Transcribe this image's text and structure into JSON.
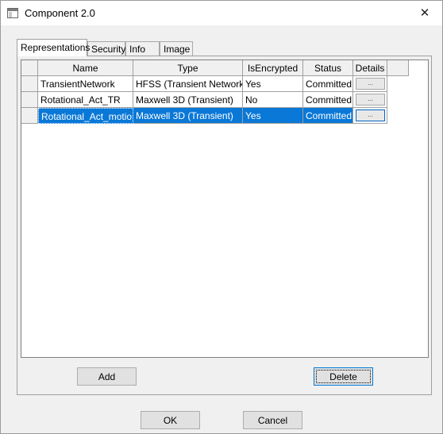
{
  "window": {
    "title": "Component 2.0",
    "close_glyph": "✕"
  },
  "tabs": [
    {
      "label": "Representations",
      "active": true
    },
    {
      "label": "Security",
      "active": false
    },
    {
      "label": "Info",
      "active": false
    },
    {
      "label": "Image",
      "active": false
    }
  ],
  "table": {
    "columns": [
      "Name",
      "Type",
      "IsEncrypted",
      "Status",
      "Details"
    ],
    "details_button_label": "...",
    "rows": [
      {
        "name": "TransientNetwork",
        "type": "HFSS (Transient Network)",
        "encrypted": "Yes",
        "status": "Committed",
        "selected": false
      },
      {
        "name": "Rotational_Act_TR",
        "type": "Maxwell 3D (Transient)",
        "encrypted": "No",
        "status": "Committed",
        "selected": false
      },
      {
        "name": "Rotational_Act_motion",
        "type": "Maxwell 3D (Transient)",
        "encrypted": "Yes",
        "status": "Committed",
        "selected": true
      }
    ]
  },
  "buttons": {
    "add": "Add",
    "delete": "Delete",
    "ok": "OK",
    "cancel": "Cancel"
  },
  "colors": {
    "selection": "#0a78d7",
    "focus": "#0078d7"
  },
  "icons": {
    "app": "window-icon",
    "close": "close-icon",
    "details": "ellipsis-icon"
  }
}
